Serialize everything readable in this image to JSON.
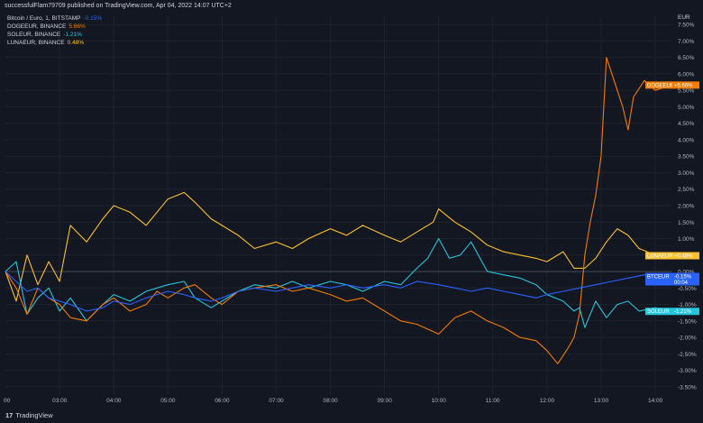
{
  "header": {
    "publisher_line": "successfulFlam79709 published on TradingView.com, Apr 04, 2022 14:07 UTC+2"
  },
  "legend": [
    {
      "name": "Bitcoin / Euro, 1, BITSTAMP",
      "value": "-0.15%",
      "color": "#2962ff"
    },
    {
      "name": "DOGEEUR, BINANCE",
      "value": "5.66%",
      "color": "#f57c00"
    },
    {
      "name": "SOLEUR, BINANCE",
      "value": "-1.21%",
      "color": "#26c6da"
    },
    {
      "name": "LUNAEUR, BINANCE",
      "value": "0.48%",
      "color": "#fbc02d"
    }
  ],
  "axis": {
    "unit": "EUR"
  },
  "footer": {
    "logo_mark": "17",
    "logo_text": "TradingView"
  },
  "chart_data": {
    "type": "line",
    "x_ticks": [
      "00",
      "03:00",
      "04:00",
      "05:00",
      "06:00",
      "07:00",
      "08:00",
      "09:00",
      "10:00",
      "11:00",
      "12:00",
      "13:00",
      "14:00"
    ],
    "x_range": [
      2.0,
      14.3
    ],
    "y_ticks": [
      "7.50%",
      "7.00%",
      "6.50%",
      "6.00%",
      "5.50%",
      "5.00%",
      "4.50%",
      "4.00%",
      "3.50%",
      "3.00%",
      "2.50%",
      "2.00%",
      "1.50%",
      "1.00%",
      "0.50%",
      "0.00%",
      "-0.50%",
      "-1.00%",
      "-1.50%",
      "-2.00%",
      "-2.50%",
      "-3.00%",
      "-3.50%"
    ],
    "y_range": [
      -3.75,
      7.75
    ],
    "y_unit": "%",
    "series": [
      {
        "name": "LUNAEUR",
        "label": "LUNAEUR",
        "badge_value": "+0.48%",
        "color": "#fbc02d",
        "x": [
          2.0,
          2.2,
          2.4,
          2.6,
          2.8,
          3.0,
          3.2,
          3.5,
          3.8,
          4.0,
          4.3,
          4.6,
          4.8,
          5.0,
          5.3,
          5.5,
          5.8,
          6.0,
          6.3,
          6.6,
          7.0,
          7.3,
          7.6,
          8.0,
          8.3,
          8.6,
          9.0,
          9.3,
          9.6,
          9.9,
          10.0,
          10.3,
          10.6,
          10.9,
          11.2,
          11.5,
          11.8,
          12.0,
          12.3,
          12.5,
          12.7,
          12.9,
          13.1,
          13.3,
          13.5,
          13.7,
          14.0,
          14.3
        ],
        "y": [
          0.0,
          -0.9,
          0.5,
          -0.4,
          0.3,
          -0.3,
          1.4,
          0.9,
          1.6,
          2.0,
          1.8,
          1.4,
          1.8,
          2.2,
          2.4,
          2.1,
          1.6,
          1.4,
          1.1,
          0.7,
          0.9,
          0.7,
          1.0,
          1.3,
          1.1,
          1.4,
          1.1,
          0.9,
          1.2,
          1.5,
          1.9,
          1.5,
          1.2,
          0.8,
          0.6,
          0.5,
          0.4,
          0.3,
          0.6,
          0.1,
          0.1,
          0.4,
          0.9,
          1.3,
          1.1,
          0.7,
          0.5,
          0.48
        ]
      },
      {
        "name": "SOLEUR",
        "label": "SOLEUR",
        "badge_value": "-1.21%",
        "color": "#26c6da",
        "x": [
          2.0,
          2.2,
          2.4,
          2.6,
          2.8,
          3.0,
          3.2,
          3.5,
          3.8,
          4.0,
          4.3,
          4.6,
          4.8,
          5.0,
          5.3,
          5.5,
          5.8,
          6.0,
          6.3,
          6.6,
          7.0,
          7.3,
          7.6,
          8.0,
          8.3,
          8.6,
          9.0,
          9.3,
          9.6,
          9.8,
          10.0,
          10.2,
          10.4,
          10.6,
          10.9,
          11.2,
          11.5,
          11.8,
          12.0,
          12.3,
          12.5,
          12.6,
          12.7,
          12.9,
          13.1,
          13.3,
          13.5,
          13.7,
          14.0,
          14.3
        ],
        "y": [
          0.0,
          0.3,
          -1.3,
          -0.8,
          -0.5,
          -1.2,
          -0.8,
          -1.5,
          -1.0,
          -0.7,
          -0.9,
          -0.6,
          -0.5,
          -0.4,
          -0.3,
          -0.8,
          -1.1,
          -0.9,
          -0.6,
          -0.4,
          -0.5,
          -0.3,
          -0.5,
          -0.3,
          -0.4,
          -0.6,
          -0.3,
          -0.4,
          0.1,
          0.4,
          1.0,
          0.4,
          0.5,
          0.9,
          0.0,
          -0.1,
          -0.2,
          -0.4,
          -0.7,
          -0.9,
          -1.2,
          -1.1,
          -1.7,
          -0.9,
          -1.4,
          -1.0,
          -0.9,
          -1.2,
          -1.1,
          -1.21
        ]
      },
      {
        "name": "DOGEEUR",
        "label": "DOGEEUR",
        "badge_value": "+5.66%",
        "color": "#f57c00",
        "x": [
          2.0,
          2.2,
          2.4,
          2.6,
          2.8,
          3.0,
          3.2,
          3.5,
          3.8,
          4.0,
          4.3,
          4.6,
          4.8,
          5.0,
          5.3,
          5.5,
          5.8,
          6.0,
          6.3,
          6.6,
          7.0,
          7.3,
          7.6,
          8.0,
          8.3,
          8.6,
          9.0,
          9.3,
          9.6,
          10.0,
          10.3,
          10.6,
          10.9,
          11.2,
          11.5,
          11.8,
          12.0,
          12.2,
          12.4,
          12.5,
          12.6,
          12.7,
          12.8,
          12.9,
          13.0,
          13.1,
          13.2,
          13.4,
          13.5,
          13.6,
          13.8,
          14.0,
          14.3
        ],
        "y": [
          0.0,
          -0.5,
          -1.3,
          -0.5,
          -0.8,
          -1.0,
          -1.4,
          -1.5,
          -1.0,
          -0.8,
          -1.2,
          -1.0,
          -0.6,
          -0.8,
          -0.5,
          -0.4,
          -0.8,
          -1.0,
          -0.6,
          -0.5,
          -0.4,
          -0.6,
          -0.5,
          -0.7,
          -0.9,
          -0.8,
          -1.2,
          -1.5,
          -1.6,
          -1.9,
          -1.4,
          -1.2,
          -1.5,
          -1.7,
          -2.0,
          -2.1,
          -2.4,
          -2.8,
          -2.3,
          -2.0,
          -1.3,
          0.5,
          1.5,
          2.3,
          3.5,
          6.5,
          6.0,
          5.0,
          4.3,
          5.3,
          5.8,
          5.5,
          5.66
        ]
      },
      {
        "name": "BTCEUR",
        "label": "BTCEUR",
        "badge_value": "-0.15%",
        "badge_sub": "00:04",
        "color": "#2962ff",
        "x": [
          2.0,
          2.2,
          2.4,
          2.6,
          2.8,
          3.0,
          3.2,
          3.5,
          3.8,
          4.0,
          4.3,
          4.6,
          4.8,
          5.0,
          5.3,
          5.5,
          5.8,
          6.0,
          6.3,
          6.6,
          7.0,
          7.3,
          7.6,
          8.0,
          8.3,
          8.6,
          9.0,
          9.3,
          9.6,
          10.0,
          10.3,
          10.6,
          10.9,
          11.2,
          11.5,
          11.8,
          12.0,
          12.3,
          12.6,
          12.9,
          13.2,
          13.5,
          13.8,
          14.0,
          14.3
        ],
        "y": [
          0.0,
          -0.3,
          -0.6,
          -0.5,
          -0.8,
          -0.9,
          -1.0,
          -1.2,
          -1.1,
          -0.9,
          -1.0,
          -0.8,
          -0.7,
          -0.6,
          -0.7,
          -0.8,
          -0.9,
          -0.8,
          -0.6,
          -0.5,
          -0.6,
          -0.5,
          -0.4,
          -0.5,
          -0.4,
          -0.5,
          -0.4,
          -0.5,
          -0.3,
          -0.4,
          -0.5,
          -0.6,
          -0.5,
          -0.6,
          -0.7,
          -0.8,
          -0.7,
          -0.6,
          -0.5,
          -0.4,
          -0.3,
          -0.2,
          -0.1,
          -0.2,
          -0.15
        ]
      }
    ]
  }
}
